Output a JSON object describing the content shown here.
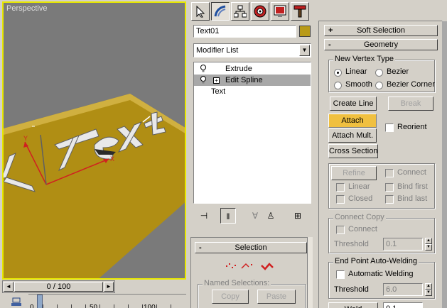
{
  "viewport": {
    "label": "Perspective",
    "scene_text": "Text"
  },
  "timeline": {
    "frame_display": "0 / 100",
    "prev_arrow": "◄",
    "next_arrow": "►",
    "ticks": [
      "0",
      "50",
      "100"
    ]
  },
  "command_panel": {
    "tabs": [
      "create-icon",
      "modify-icon",
      "hierarchy-icon",
      "motion-icon",
      "display-icon",
      "utilities-icon"
    ],
    "object_name": "Text01",
    "object_color": "#b89a18",
    "modifier_list": "Modifier List",
    "stack": [
      {
        "label": "Extrude",
        "bulb": true,
        "expander": false
      },
      {
        "label": "Edit Spline",
        "bulb": true,
        "expander": true
      },
      {
        "label": "Text",
        "bulb": false,
        "expander": false
      }
    ]
  },
  "selection_rollout": {
    "title": "Selection",
    "toggle": "-",
    "named_selections": "Named Selections:",
    "copy": "Copy",
    "paste": "Paste"
  },
  "right_panel": {
    "soft_selection": {
      "title": "Soft Selection",
      "toggle": "+"
    },
    "geometry": {
      "title": "Geometry",
      "toggle": "-",
      "new_vertex_type": "New Vertex Type",
      "linear": "Linear",
      "bezier": "Bezier",
      "smooth": "Smooth",
      "bezier_corner": "Bezier Corner",
      "create_line": "Create Line",
      "break": "Break",
      "attach": "Attach",
      "reorient": "Reorient",
      "attach_mult": "Attach Mult.",
      "cross_section": "Cross Section",
      "refine": "Refine",
      "connect": "Connect",
      "linear2": "Linear",
      "bind_first": "Bind first",
      "closed": "Closed",
      "bind_last": "Bind last",
      "connect_copy": "Connect Copy",
      "connect2": "Connect",
      "threshold": "Threshold",
      "threshold_val": "0.1",
      "end_point_welding": "End Point Auto-Welding",
      "automatic_welding": "Automatic Welding",
      "threshold2": "Threshold",
      "threshold2_val": "6.0",
      "weld": "Weld",
      "weld_val": "0.1"
    }
  }
}
